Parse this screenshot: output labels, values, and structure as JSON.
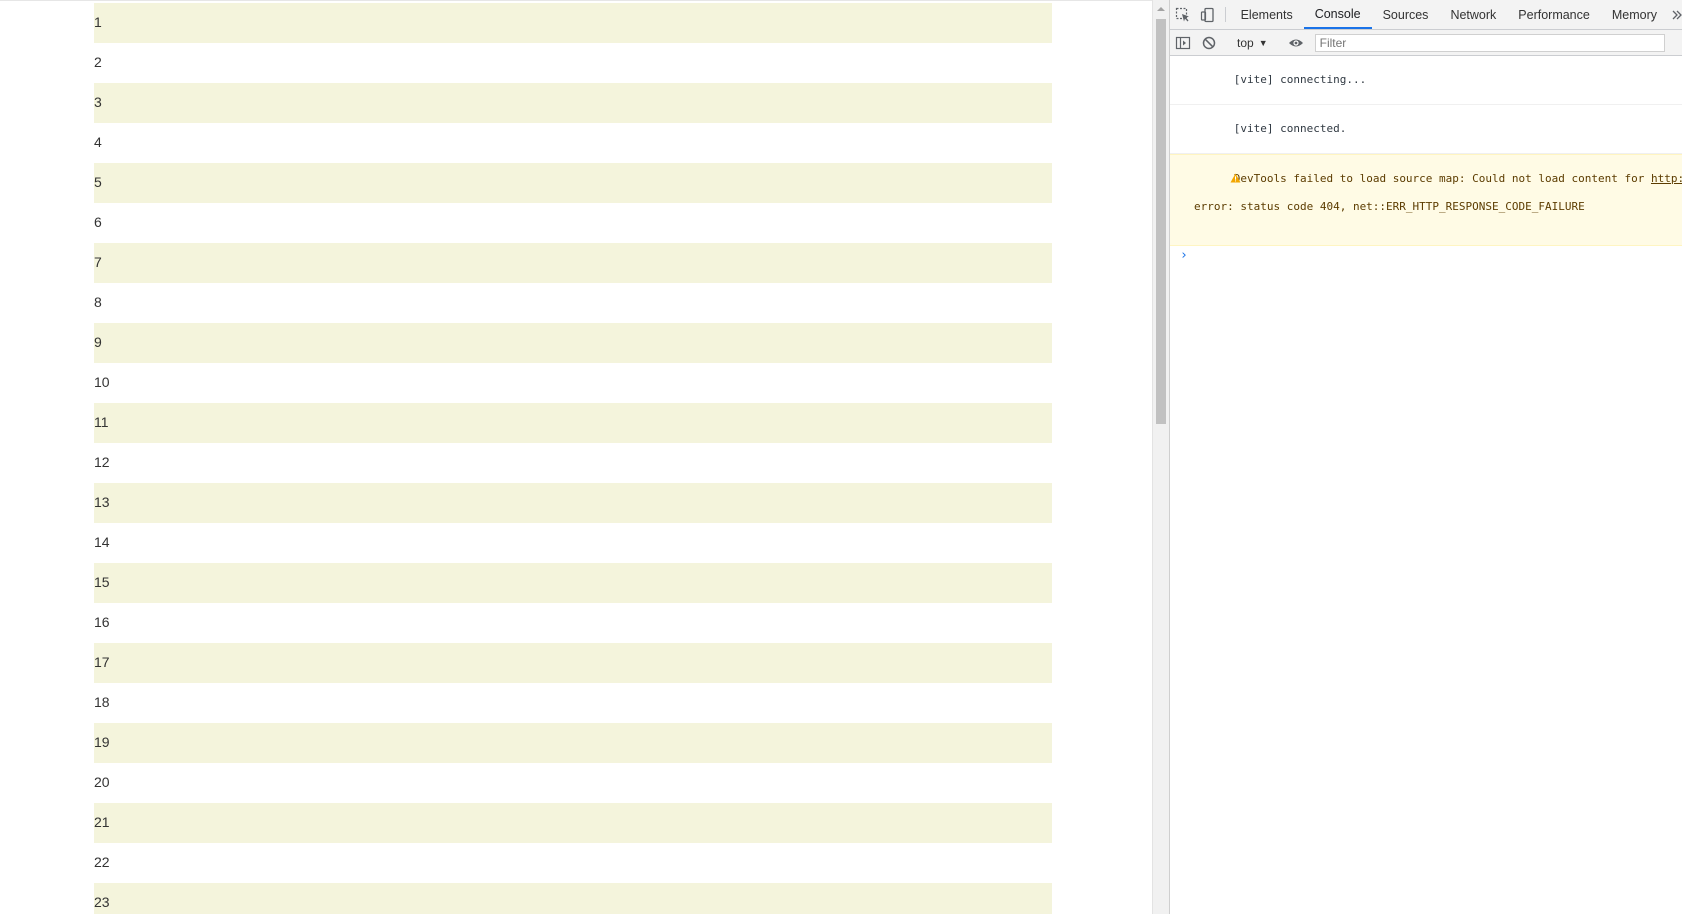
{
  "rows": [
    "1",
    "2",
    "3",
    "4",
    "5",
    "6",
    "7",
    "8",
    "9",
    "10",
    "11",
    "12",
    "13",
    "14",
    "15",
    "16",
    "17",
    "18",
    "19",
    "20",
    "21",
    "22",
    "23"
  ],
  "devtools": {
    "tabs": [
      {
        "label": "Elements",
        "active": false
      },
      {
        "label": "Console",
        "active": true
      },
      {
        "label": "Sources",
        "active": false
      },
      {
        "label": "Network",
        "active": false
      },
      {
        "label": "Performance",
        "active": false
      },
      {
        "label": "Memory",
        "active": false
      }
    ],
    "more_tabs_icon": "chevron-double-right-icon",
    "context": "top",
    "filter_placeholder": "Filter",
    "messages": [
      {
        "level": "info",
        "text": "[vite] connecting..."
      },
      {
        "level": "info",
        "text": "[vite] connected."
      },
      {
        "level": "warning",
        "text": "DevTools failed to load source map: Could not load content for ",
        "link": "http://loca",
        "text2": "error: status code 404, net::ERR_HTTP_RESPONSE_CODE_FAILURE"
      }
    ],
    "prompt_symbol": "›"
  },
  "colors": {
    "row_odd": "#f4f4dc",
    "accent": "#1a73e8",
    "warning_bg": "#fffbe5"
  }
}
